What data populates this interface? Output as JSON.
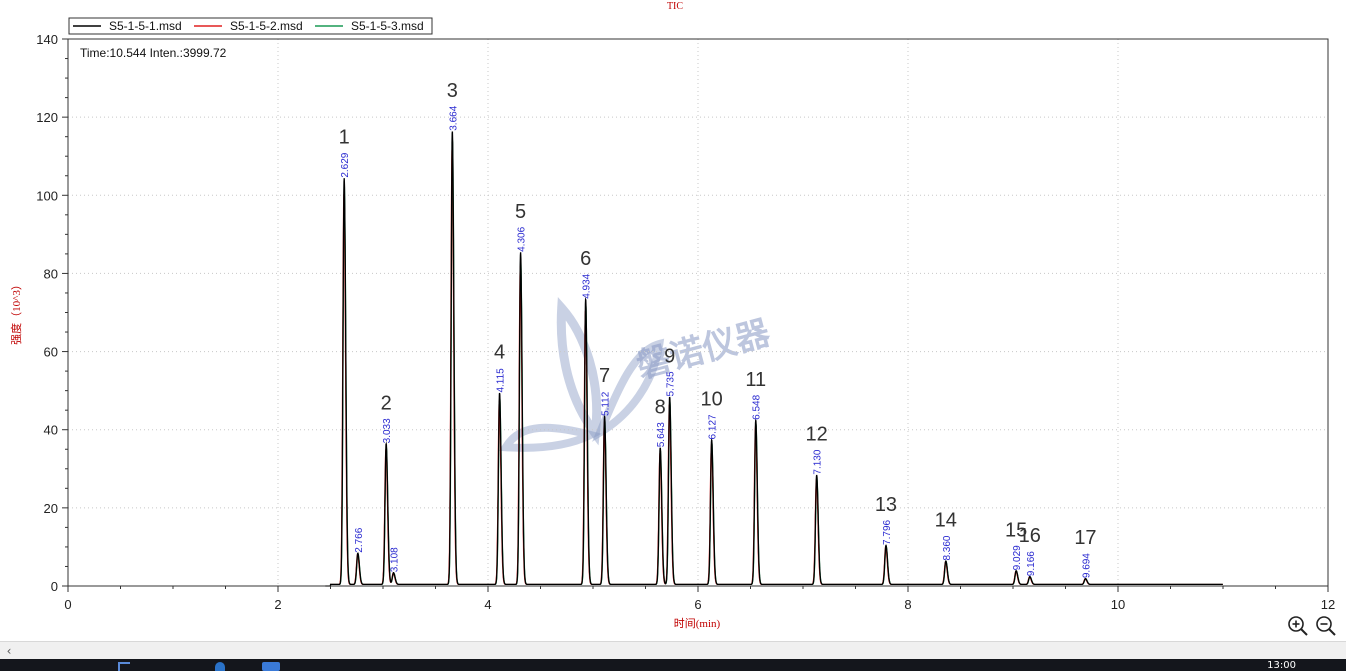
{
  "chart_data": {
    "type": "line",
    "title": "TIC",
    "xlabel": "时间(min)",
    "ylabel": "强度（10^3）",
    "xlim": [
      0,
      12
    ],
    "ylim": [
      0,
      140
    ],
    "xticks": [
      0,
      2,
      4,
      6,
      8,
      10,
      12
    ],
    "yticks": [
      0,
      20,
      40,
      60,
      80,
      100,
      120,
      140
    ],
    "grid": true,
    "legend_position": "top-left",
    "series": [
      {
        "name": "S5-1-5-1.msd",
        "color": "#000000"
      },
      {
        "name": "S5-1-5-2.msd",
        "color": "#e02020"
      },
      {
        "name": "S5-1-5-3.msd",
        "color": "#1a9a55"
      }
    ],
    "baseline_range": [
      2.5,
      11.0
    ],
    "peaks": [
      {
        "number": "1",
        "rt": 2.63,
        "height": 104,
        "rt_label": "2.629"
      },
      {
        "number": "",
        "rt": 2.76,
        "height": 8,
        "rt_label": "2.766"
      },
      {
        "number": "2",
        "rt": 3.03,
        "height": 36,
        "rt_label": "3.033"
      },
      {
        "number": "",
        "rt": 3.1,
        "height": 3,
        "rt_label": "3.108"
      },
      {
        "number": "3",
        "rt": 3.66,
        "height": 116,
        "rt_label": "3.664"
      },
      {
        "number": "4",
        "rt": 4.11,
        "height": 49,
        "rt_label": "4.115"
      },
      {
        "number": "5",
        "rt": 4.31,
        "height": 85,
        "rt_label": "4.306"
      },
      {
        "number": "6",
        "rt": 4.93,
        "height": 73,
        "rt_label": "4.934"
      },
      {
        "number": "7",
        "rt": 5.11,
        "height": 43,
        "rt_label": "5.112"
      },
      {
        "number": "8",
        "rt": 5.64,
        "height": 35,
        "rt_label": "5.643"
      },
      {
        "number": "9",
        "rt": 5.73,
        "height": 48,
        "rt_label": "5.735"
      },
      {
        "number": "10",
        "rt": 6.13,
        "height": 37,
        "rt_label": "6.127"
      },
      {
        "number": "11",
        "rt": 6.55,
        "height": 42,
        "rt_label": "6.548"
      },
      {
        "number": "12",
        "rt": 7.13,
        "height": 28,
        "rt_label": "7.130"
      },
      {
        "number": "13",
        "rt": 7.79,
        "height": 10,
        "rt_label": "7.796"
      },
      {
        "number": "14",
        "rt": 8.36,
        "height": 6,
        "rt_label": "8.360"
      },
      {
        "number": "15",
        "rt": 9.03,
        "height": 3.5,
        "rt_label": "9.029"
      },
      {
        "number": "16",
        "rt": 9.16,
        "height": 2,
        "rt_label": "9.166"
      },
      {
        "number": "17",
        "rt": 9.69,
        "height": 1.5,
        "rt_label": "9.694"
      }
    ]
  },
  "cursor_readout": "Time:10.544  Inten.:3999.72",
  "watermark": "磐诺仪器",
  "toolbar": {
    "zoom_in_icon": "zoom-in-icon",
    "zoom_out_icon": "zoom-out-icon"
  },
  "taskbar": {
    "clock": "13:00"
  }
}
